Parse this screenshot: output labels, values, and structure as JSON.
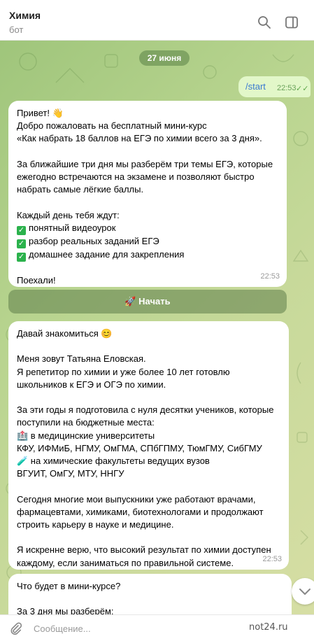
{
  "header": {
    "title": "Химия",
    "subtitle": "бот",
    "search_icon": "search-icon",
    "sidebar_icon": "sidebar-toggle-icon"
  },
  "chat": {
    "date": "27 июня",
    "outgoing": {
      "text": "/start",
      "time": "22:53",
      "status": "read"
    },
    "messages": [
      {
        "lines": [
          "Привет! 👋",
          "Добро пожаловать на бесплатный мини-курс",
          "«Как набрать 18 баллов на ЕГЭ по химии всего за 3 дня».",
          "",
          "За ближайшие три дня мы разберём три темы ЕГЭ, которые",
          "ежегодно встречаются на экзамене и позволяют быстро",
          "набрать самые лёгкие баллы.",
          "",
          "Каждый день тебя ждут:"
        ],
        "checklist": [
          "понятный видеоурок",
          "разбор реальных заданий ЕГЭ",
          "домашнее задание для закрепления"
        ],
        "closing": [
          "",
          "Поехали!"
        ],
        "time": "22:53"
      },
      {
        "lines": [
          "Давай знакомиться 😊",
          "",
          "Меня зовут Татьяна Еловская.",
          "Я репетитор по химии и уже более 10 лет готовлю",
          "школьников к ЕГЭ и ОГЭ по химии.",
          "",
          "За эти годы я подготовила с нуля десятки учеников, которые",
          "поступили на бюджетные места:",
          "🏥 в медицинские университеты",
          "КФУ, ИФМиБ, НГМУ, ОмГМА, СПбГПМУ, ТюмГМУ, СибГМУ",
          "🧪 на химические факультеты ведущих вузов",
          "ВГУИТ, ОмГУ, МТУ, ННГУ",
          "",
          "Сегодня многие мои выпускники уже работают врачами,",
          "фармацевтами, химиками, биотехнологами и продолжают",
          "строить карьеру в науке и медицине.",
          "",
          "Я искренне верю, что высокий результат по химии доступен",
          "каждому, если заниматься по правильной системе."
        ],
        "time": "22:53"
      },
      {
        "lines": [
          "Что будет в мини-курсе?",
          "",
          "За 3 дня мы разберём:"
        ]
      }
    ],
    "inline_button": "🚀 Начать"
  },
  "composer": {
    "placeholder": "Сообщение...",
    "watermark": "not24.ru"
  },
  "colors": {
    "accent": "#3a7ad1",
    "outgoing_bg": "#e2f7c9",
    "wallpaper": "#b8d48f"
  }
}
